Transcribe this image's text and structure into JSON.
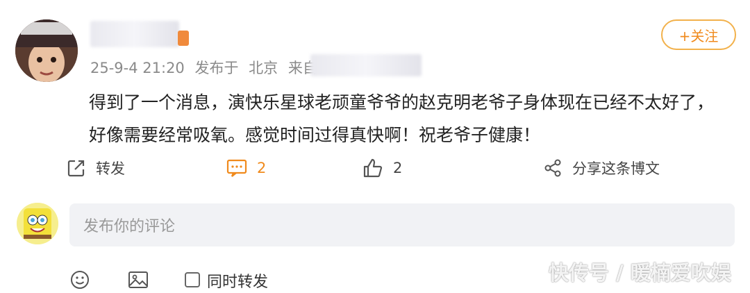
{
  "user": {
    "timestamp": "25-9-4 21:20",
    "published_label": "发布于",
    "location": "北京",
    "source_prefix": "来自"
  },
  "follow": {
    "label": "+关注"
  },
  "post": {
    "line1": "得到了一个消息，演快乐星球老顽童爷爷的赵克明老爷子身体现在已经不太好了，",
    "line2": "好像需要经常吸氧。感觉时间过得真快啊！祝老爷子健康！"
  },
  "actions": {
    "repost": "转发",
    "comment_count": "2",
    "like_count": "2",
    "share": "分享这条博文"
  },
  "comment_box": {
    "placeholder": "发布你的评论"
  },
  "toolbar": {
    "repost_also": "同时转发"
  },
  "watermark": "快传号 / 暖楠爱吹娱",
  "colors": {
    "accent": "#f08a1c",
    "follow_border": "#f2b14b",
    "meta": "#8a8a8a"
  },
  "icons": [
    "repost-icon",
    "comment-icon",
    "like-icon",
    "share-icon",
    "emoji-icon",
    "image-icon"
  ]
}
